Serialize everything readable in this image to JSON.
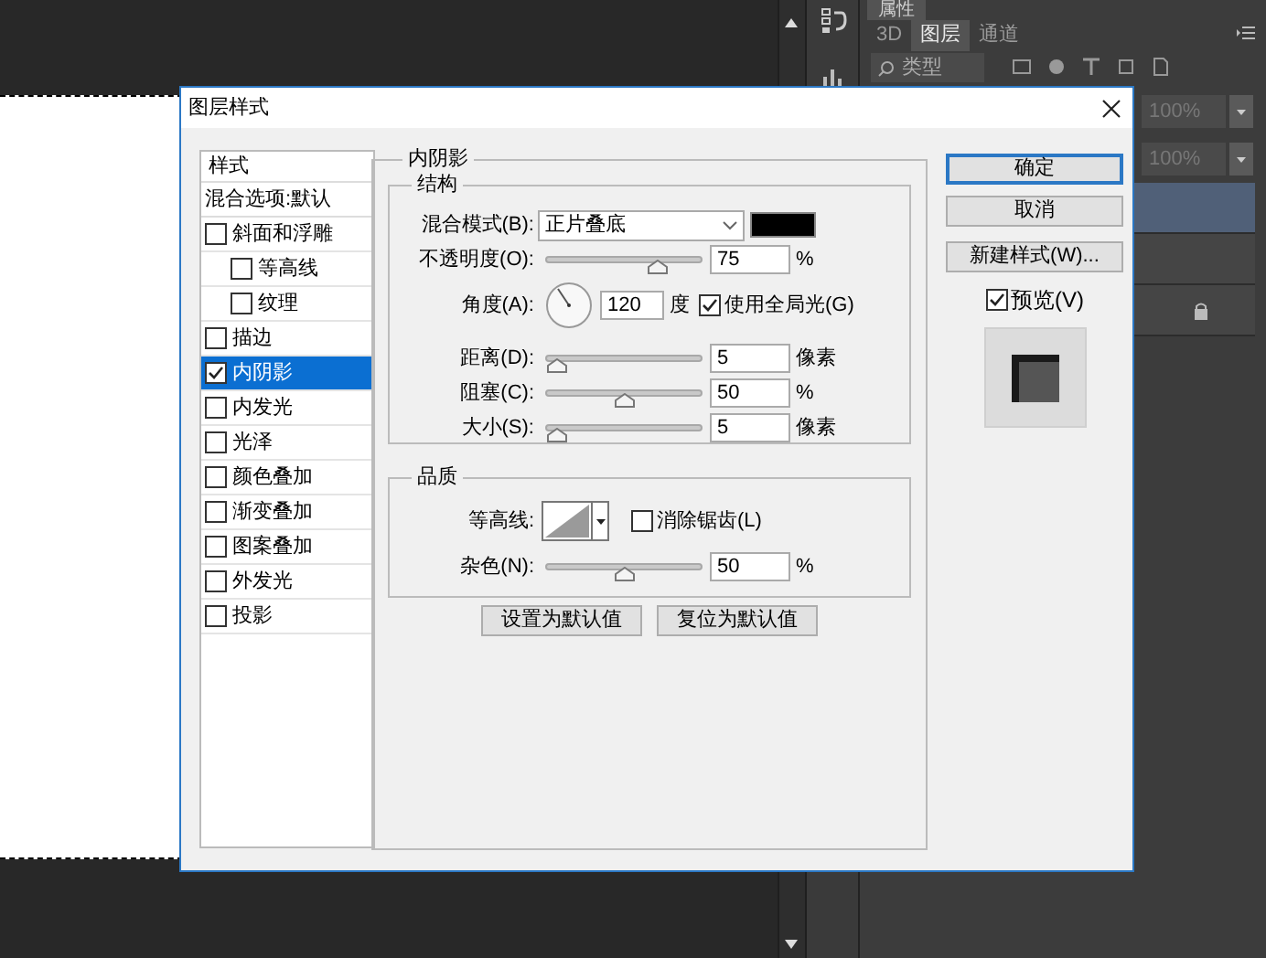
{
  "panels": {
    "properties_tab": "属性",
    "tabs": [
      {
        "label": "3D",
        "selected": false
      },
      {
        "label": "图层",
        "selected": true
      },
      {
        "label": "通道",
        "selected": false
      }
    ],
    "filter": {
      "label": "类型"
    },
    "opacity_fields": [
      "100%",
      "100%"
    ],
    "layers": [
      {
        "selected": true,
        "locked": false
      },
      {
        "selected": false,
        "locked": false
      },
      {
        "selected": false,
        "locked": true
      }
    ]
  },
  "dialog": {
    "title": "图层样式",
    "styles_header": "样式",
    "blending_options": "混合选项:默认",
    "style_items": [
      {
        "label": "斜面和浮雕",
        "checked": false,
        "selected": false,
        "children": [
          {
            "label": "等高线",
            "checked": false,
            "selected": false
          },
          {
            "label": "纹理",
            "checked": false,
            "selected": false
          }
        ]
      },
      {
        "label": "描边",
        "checked": false,
        "selected": false
      },
      {
        "label": "内阴影",
        "checked": true,
        "selected": true
      },
      {
        "label": "内发光",
        "checked": false,
        "selected": false
      },
      {
        "label": "光泽",
        "checked": false,
        "selected": false
      },
      {
        "label": "颜色叠加",
        "checked": false,
        "selected": false
      },
      {
        "label": "渐变叠加",
        "checked": false,
        "selected": false
      },
      {
        "label": "图案叠加",
        "checked": false,
        "selected": false
      },
      {
        "label": "外发光",
        "checked": false,
        "selected": false
      },
      {
        "label": "投影",
        "checked": false,
        "selected": false
      }
    ],
    "section_title": "内阴影",
    "structure": {
      "title": "结构",
      "blend_mode": {
        "label": "混合模式(B):",
        "value": "正片叠底",
        "color": "#000000"
      },
      "opacity": {
        "label": "不透明度(O):",
        "level": 0.75,
        "value": "75",
        "unit": "%"
      },
      "angle": {
        "label": "角度(A):",
        "value": "120",
        "unit": "度",
        "global_light": {
          "label": "使用全局光(G)",
          "checked": true
        }
      },
      "sliders": [
        {
          "label": "距离(D):",
          "level": 0.0,
          "value": "5",
          "unit": "像素"
        },
        {
          "label": "阻塞(C):",
          "level": 0.5,
          "value": "50",
          "unit": "%"
        },
        {
          "label": "大小(S):",
          "level": 0.0,
          "value": "5",
          "unit": "像素"
        }
      ]
    },
    "quality": {
      "title": "品质",
      "contour_label": "等高线:",
      "anti_alias": {
        "label": "消除锯齿(L)",
        "checked": false
      },
      "noise": {
        "label": "杂色(N):",
        "level": 0.5,
        "value": "50",
        "unit": "%"
      }
    },
    "default_buttons": [
      "设置为默认值",
      "复位为默认值"
    ],
    "action_buttons": [
      {
        "label": "确定",
        "default": true
      },
      {
        "label": "取消",
        "default": false
      },
      {
        "label": "新建样式(W)...",
        "default": false
      }
    ],
    "preview": {
      "label": "预览(V)",
      "checked": true
    }
  }
}
